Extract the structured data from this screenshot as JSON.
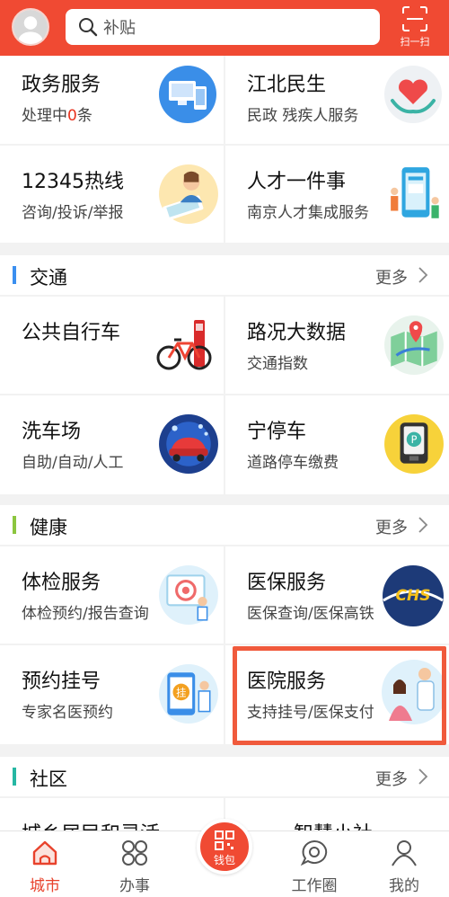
{
  "header": {
    "search_placeholder": "补贴",
    "scan_label": "扫一扫",
    "accent_color": "#f04a33"
  },
  "services_top": [
    {
      "title": "政务服务",
      "sub_prefix": "处理中",
      "sub_count": "0",
      "sub_suffix": "条",
      "icon": "computer-icon"
    },
    {
      "title": "江北民生",
      "sub": "民政  残疾人服务",
      "icon": "heart-hands-icon"
    },
    {
      "title": "12345热线",
      "sub": "咨询/投诉/举报",
      "icon": "operator-icon"
    },
    {
      "title": "人才一件事",
      "sub": "南京人才集成服务",
      "icon": "talent-icon"
    }
  ],
  "sections": [
    {
      "title": "交通",
      "more": "更多",
      "bar_color": "#3b8ff0",
      "items": [
        {
          "title": "公共自行车",
          "sub": "",
          "icon": "bicycle-icon"
        },
        {
          "title": "路况大数据",
          "sub": "交通指数",
          "icon": "map-icon"
        },
        {
          "title": "洗车场",
          "sub": "自助/自动/人工",
          "icon": "car-wash-icon"
        },
        {
          "title": "宁停车",
          "sub": "道路停车缴费",
          "icon": "parking-icon"
        }
      ]
    },
    {
      "title": "健康",
      "more": "更多",
      "bar_color": "#8cc63f",
      "items": [
        {
          "title": "体检服务",
          "sub": "体检预约/报告查询",
          "icon": "checkup-icon"
        },
        {
          "title": "医保服务",
          "sub": "医保查询/医保高铁",
          "icon": "chs-icon",
          "logo_text": "CHS"
        },
        {
          "title": "预约挂号",
          "sub": "专家名医预约",
          "icon": "register-icon",
          "badge": "挂"
        },
        {
          "title": "医院服务",
          "sub": "支持挂号/医保支付",
          "icon": "hospital-icon"
        }
      ]
    },
    {
      "title": "社区",
      "more": "更多",
      "bar_color": "#26b7a3",
      "items": [
        {
          "title": "城乡居民和灵活…",
          "icon": "community-icon"
        },
        {
          "title": "智慧小社…",
          "icon": "smart-icon"
        }
      ]
    }
  ],
  "bottom_nav": [
    {
      "label": "城市",
      "icon": "city-icon",
      "active": true
    },
    {
      "label": "办事",
      "icon": "grid-icon",
      "active": false
    },
    {
      "label": "钱包",
      "icon": "wallet-icon",
      "active": false
    },
    {
      "label": "工作圈",
      "icon": "chat-icon",
      "active": false
    },
    {
      "label": "我的",
      "icon": "user-icon",
      "active": false
    }
  ]
}
